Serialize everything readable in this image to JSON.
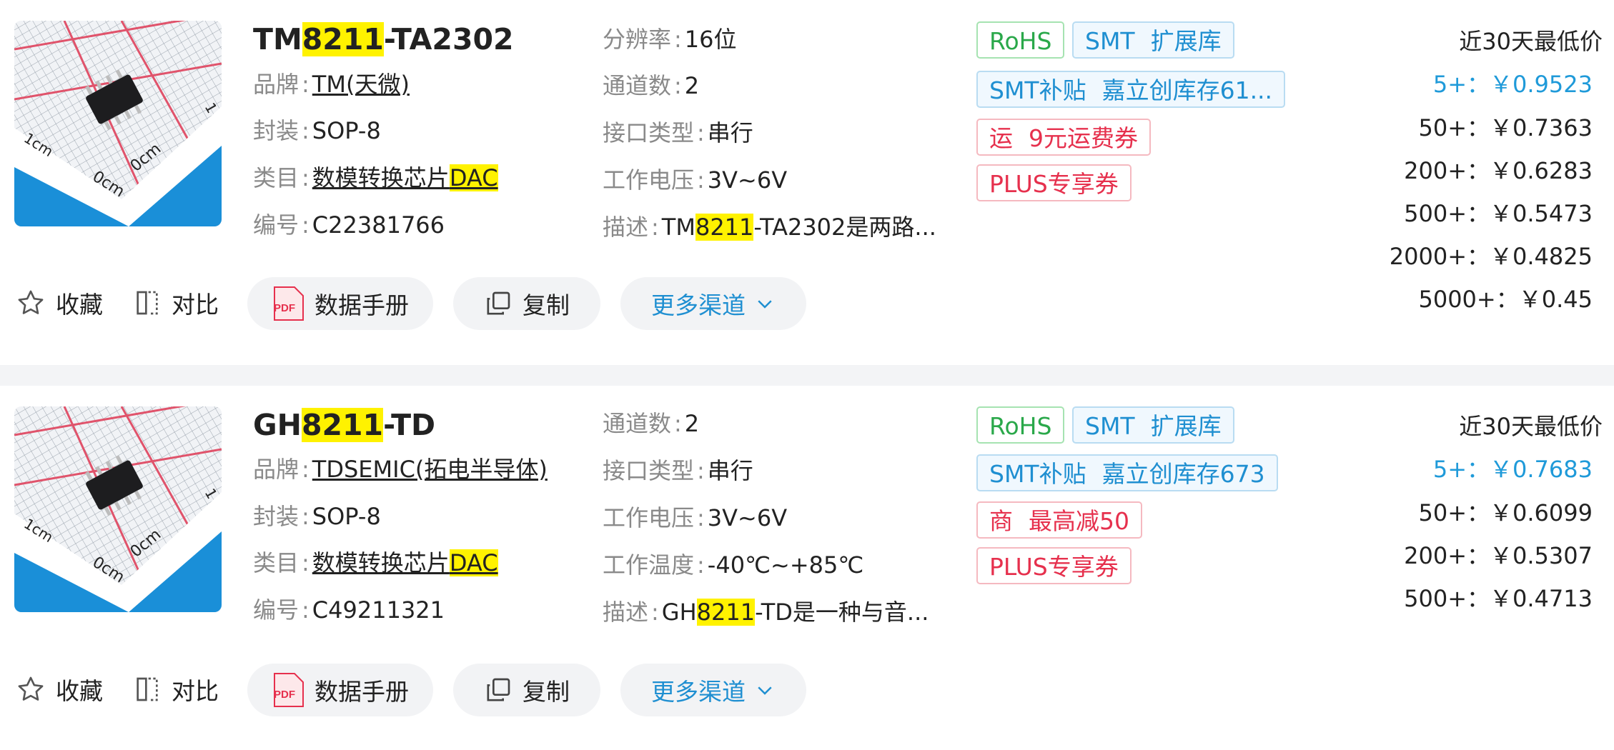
{
  "products": [
    {
      "title_prefix": "TM",
      "title_highlight": "8211",
      "title_suffix": "-TA2302",
      "left_fields": {
        "brand_label": "品牌",
        "brand_value": "TM(天微)",
        "package_label": "封装",
        "package_value": "SOP-8",
        "category_label": "类目",
        "category_value": "数模转换芯片",
        "category_highlight": "DAC",
        "code_label": "编号",
        "code_value": "C22381766"
      },
      "mid_fields": [
        {
          "label": "分辨率",
          "value": "16位"
        },
        {
          "label": "通道数",
          "value": "2"
        },
        {
          "label": "接口类型",
          "value": "串行"
        },
        {
          "label": "工作电压",
          "value": "3V~6V"
        }
      ],
      "desc_label": "描述",
      "desc_prefix": "TM",
      "desc_highlight": "8211",
      "desc_suffix": "-TA2302是两路...",
      "tags": {
        "rohs": "RoHS",
        "smt": "SMT",
        "smt_sub": "扩展库",
        "subsidy": "SMT补贴",
        "stock": "嘉立创库存61...",
        "promo_lead": "运",
        "promo_text": "9元运费券",
        "plus": "PLUS专享券"
      },
      "price_header": "近30天最低价",
      "prices": [
        {
          "qty": "5+：",
          "price": "￥0.9523"
        },
        {
          "qty": "50+：",
          "price": "￥0.7363"
        },
        {
          "qty": "200+：",
          "price": "￥0.6283"
        },
        {
          "qty": "500+：",
          "price": "￥0.5473"
        },
        {
          "qty": "2000+：",
          "price": "￥0.4825"
        },
        {
          "qty": "5000+：",
          "price": "￥0.45"
        }
      ],
      "actions": {
        "favorite": "收藏",
        "compare": "对比",
        "datasheet": "数据手册",
        "copy": "复制",
        "more": "更多渠道"
      }
    },
    {
      "title_prefix": "GH",
      "title_highlight": "8211",
      "title_suffix": "-TD",
      "left_fields": {
        "brand_label": "品牌",
        "brand_value": "TDSEMIC(拓电半导体)",
        "package_label": "封装",
        "package_value": "SOP-8",
        "category_label": "类目",
        "category_value": "数模转换芯片",
        "category_highlight": "DAC",
        "code_label": "编号",
        "code_value": "C49211321"
      },
      "mid_fields": [
        {
          "label": "通道数",
          "value": "2"
        },
        {
          "label": "接口类型",
          "value": "串行"
        },
        {
          "label": "工作电压",
          "value": "3V~6V"
        },
        {
          "label": "工作温度",
          "value": "-40℃~+85℃"
        }
      ],
      "desc_label": "描述",
      "desc_prefix": "GH",
      "desc_highlight": "8211",
      "desc_suffix": "-TD是一种与音...",
      "tags": {
        "rohs": "RoHS",
        "smt": "SMT",
        "smt_sub": "扩展库",
        "subsidy": "SMT补贴",
        "stock": "嘉立创库存673",
        "promo_lead": "商",
        "promo_text": "最高减50",
        "plus": "PLUS专享券"
      },
      "price_header": "近30天最低价",
      "prices": [
        {
          "qty": "5+：",
          "price": "￥0.7683"
        },
        {
          "qty": "50+：",
          "price": "￥0.6099"
        },
        {
          "qty": "200+：",
          "price": "￥0.5307"
        },
        {
          "qty": "500+：",
          "price": "￥0.4713"
        }
      ],
      "actions": {
        "favorite": "收藏",
        "compare": "对比",
        "datasheet": "数据手册",
        "copy": "复制",
        "more": "更多渠道"
      }
    }
  ],
  "image_labels": {
    "tick_1": "1",
    "unit_cm": "cm",
    "unit_0cm": "0cm"
  },
  "pdf_icon_text": "PDF",
  "colors": {
    "highlight": "#fff200",
    "accent_blue": "#1f8fd1",
    "accent_green": "#2aa84a",
    "accent_red": "#e6304d"
  }
}
